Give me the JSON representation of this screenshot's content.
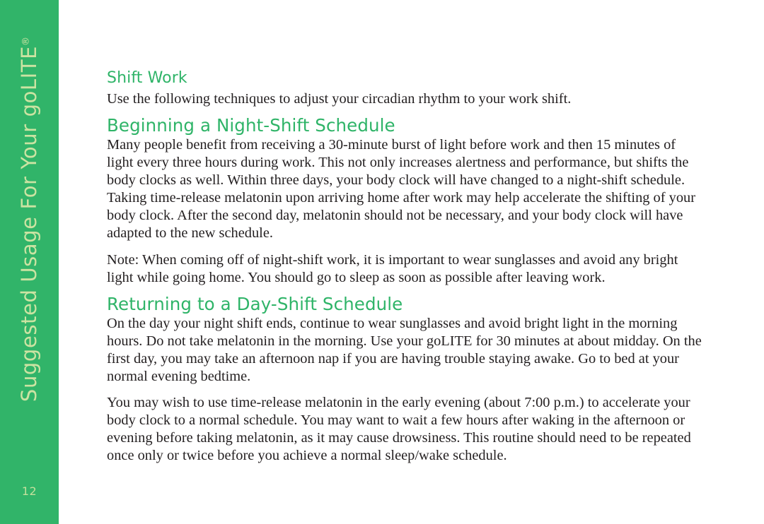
{
  "sidebar": {
    "section_title": "Suggested Usage For Your goLITE",
    "trademark_symbol": "®",
    "page_number": "12",
    "background_color": "#31b469",
    "text_color": "#cbe3a2"
  },
  "theme": {
    "heading_color": "#2fb468",
    "body_color": "#231f20",
    "page_background": "#ffffff"
  },
  "content": {
    "section_heading": "Shift Work",
    "section_intro": "Use the following techniques to adjust your circadian rhythm to your work shift.",
    "subsection_1": {
      "heading": "Beginning a Night-Shift Schedule",
      "paragraph_1": "Many people benefit from receiving a 30-minute burst of light before work and then 15 minutes of light every three hours during work. This not only increases alertness and performance, but shifts the body clocks as well. Within three days, your body clock will have changed to a night-shift schedule. Taking time-release melatonin upon arriving home after work may help accelerate the shifting of your body clock. After the second day, melatonin should not be necessary, and your body clock will have adapted to the new schedule.",
      "paragraph_2": "Note: When coming off of night-shift work, it is important to wear sunglasses and avoid any bright light while going home. You should go to sleep as soon as possible after leaving work."
    },
    "subsection_2": {
      "heading": "Returning to a Day-Shift Schedule",
      "paragraph_1": "On the day your night shift ends, continue to wear sunglasses and avoid bright light in the morning hours. Do not take melatonin in the morning. Use your goLITE for 30 minutes at about midday. On the first day, you may take an afternoon nap if you are having trouble staying awake. Go to bed at your normal evening bedtime.",
      "paragraph_2": "You may wish to use time-release melatonin in the early evening (about 7:00 p.m.) to accelerate your body clock to a normal schedule. You may want to wait a few hours after waking in the afternoon or evening before taking melatonin, as it may cause drowsiness. This routine should need to be repeated once only or twice before you achieve a normal sleep/wake schedule."
    }
  }
}
